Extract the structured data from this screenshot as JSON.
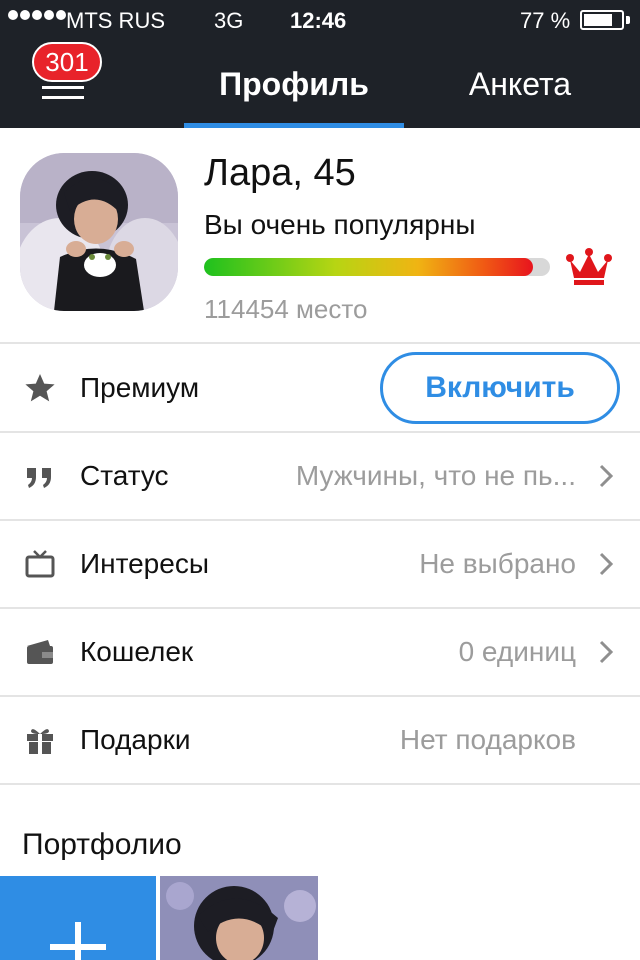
{
  "status_bar": {
    "carrier": "MTS RUS",
    "network": "3G",
    "time": "12:46",
    "battery_percent": "77 %",
    "battery_level": 0.77
  },
  "header": {
    "notification_count": "301",
    "tabs": [
      {
        "label": "Профиль",
        "active": true
      },
      {
        "label": "Анкета",
        "active": false
      }
    ],
    "accent_color": "#2f8de4",
    "background_color": "#1e2228"
  },
  "profile": {
    "name_age": "Лара, 45",
    "popularity_text": "Вы очень популярны",
    "popularity_level": 0.95,
    "rank_text": "114454 место"
  },
  "rows": [
    {
      "icon": "star-icon",
      "label": "Премиум",
      "button": "Включить"
    },
    {
      "icon": "quote-icon",
      "label": "Статус",
      "value": "Мужчины, что не пь..."
    },
    {
      "icon": "tv-icon",
      "label": "Интересы",
      "value": "Не выбрано"
    },
    {
      "icon": "wallet-icon",
      "label": "Кошелек",
      "value": "0 единиц"
    },
    {
      "icon": "gift-icon",
      "label": "Подарки",
      "value": "Нет подарков"
    }
  ],
  "portfolio": {
    "title": "Портфолио"
  }
}
